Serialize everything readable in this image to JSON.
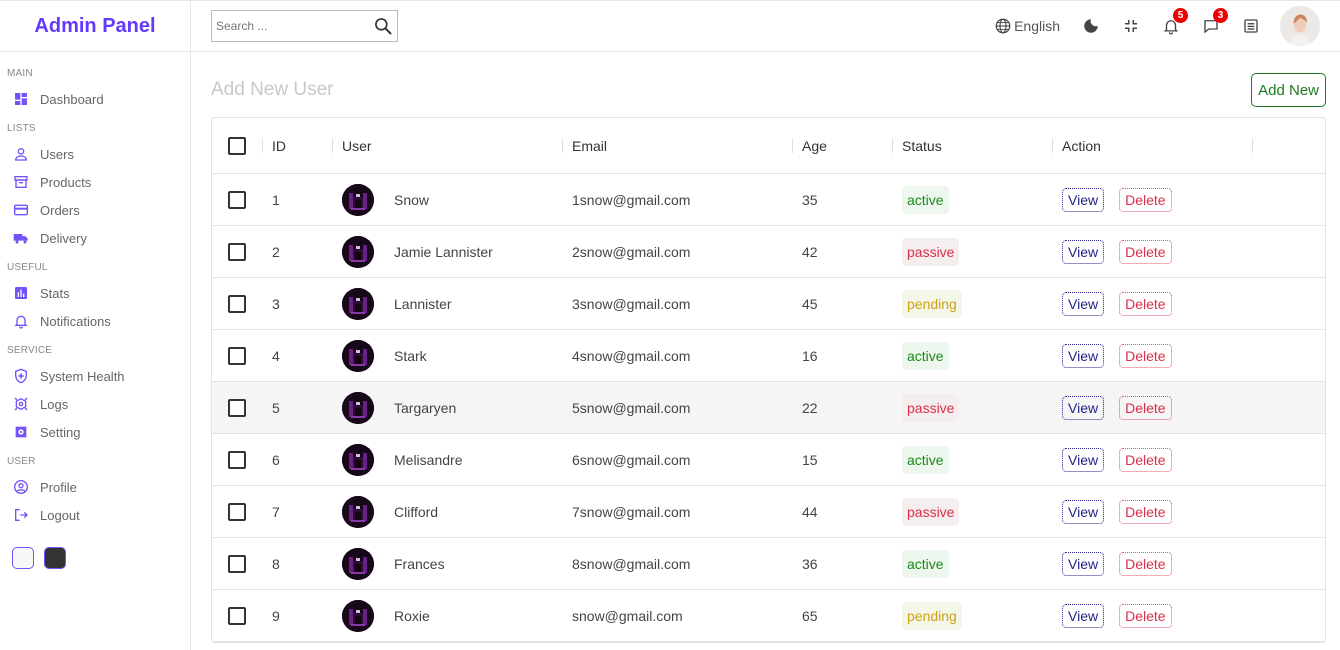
{
  "sidebar": {
    "logo": "Admin Panel",
    "sections": [
      {
        "title": "MAIN",
        "items": [
          {
            "label": "Dashboard",
            "icon": "dashboard-icon"
          }
        ]
      },
      {
        "title": "LISTS",
        "items": [
          {
            "label": "Users",
            "icon": "person-icon"
          },
          {
            "label": "Products",
            "icon": "store-icon"
          },
          {
            "label": "Orders",
            "icon": "credit-card-icon"
          },
          {
            "label": "Delivery",
            "icon": "truck-icon"
          }
        ]
      },
      {
        "title": "USEFUL",
        "items": [
          {
            "label": "Stats",
            "icon": "stats-icon"
          },
          {
            "label": "Notifications",
            "icon": "bell-icon"
          }
        ]
      },
      {
        "title": "SERVICE",
        "items": [
          {
            "label": "System Health",
            "icon": "shield-icon"
          },
          {
            "label": "Logs",
            "icon": "logs-icon"
          },
          {
            "label": "Setting",
            "icon": "settings-icon"
          }
        ]
      },
      {
        "title": "USER",
        "items": [
          {
            "label": "Profile",
            "icon": "profile-icon"
          },
          {
            "label": "Logout",
            "icon": "logout-icon"
          }
        ]
      }
    ],
    "accent_color": "#7451f8"
  },
  "topbar": {
    "search_placeholder": "Search ...",
    "language": "English",
    "notifications_count": "5",
    "messages_count": "3"
  },
  "main": {
    "title": "Add New User",
    "add_button": "Add New",
    "columns": [
      "ID",
      "User",
      "Email",
      "Age",
      "Status",
      "Action"
    ],
    "view_label": "View",
    "delete_label": "Delete",
    "rows": [
      {
        "id": "1",
        "user": "Snow",
        "email": "1snow@gmail.com",
        "age": "35",
        "status": "active"
      },
      {
        "id": "2",
        "user": "Jamie Lannister",
        "email": "2snow@gmail.com",
        "age": "42",
        "status": "passive"
      },
      {
        "id": "3",
        "user": "Lannister",
        "email": "3snow@gmail.com",
        "age": "45",
        "status": "pending"
      },
      {
        "id": "4",
        "user": "Stark",
        "email": "4snow@gmail.com",
        "age": "16",
        "status": "active"
      },
      {
        "id": "5",
        "user": "Targaryen",
        "email": "5snow@gmail.com",
        "age": "22",
        "status": "passive"
      },
      {
        "id": "6",
        "user": "Melisandre",
        "email": "6snow@gmail.com",
        "age": "15",
        "status": "active"
      },
      {
        "id": "7",
        "user": "Clifford",
        "email": "7snow@gmail.com",
        "age": "44",
        "status": "passive"
      },
      {
        "id": "8",
        "user": "Frances",
        "email": "8snow@gmail.com",
        "age": "36",
        "status": "active"
      },
      {
        "id": "9",
        "user": "Roxie",
        "email": "snow@gmail.com",
        "age": "65",
        "status": "pending"
      }
    ]
  }
}
